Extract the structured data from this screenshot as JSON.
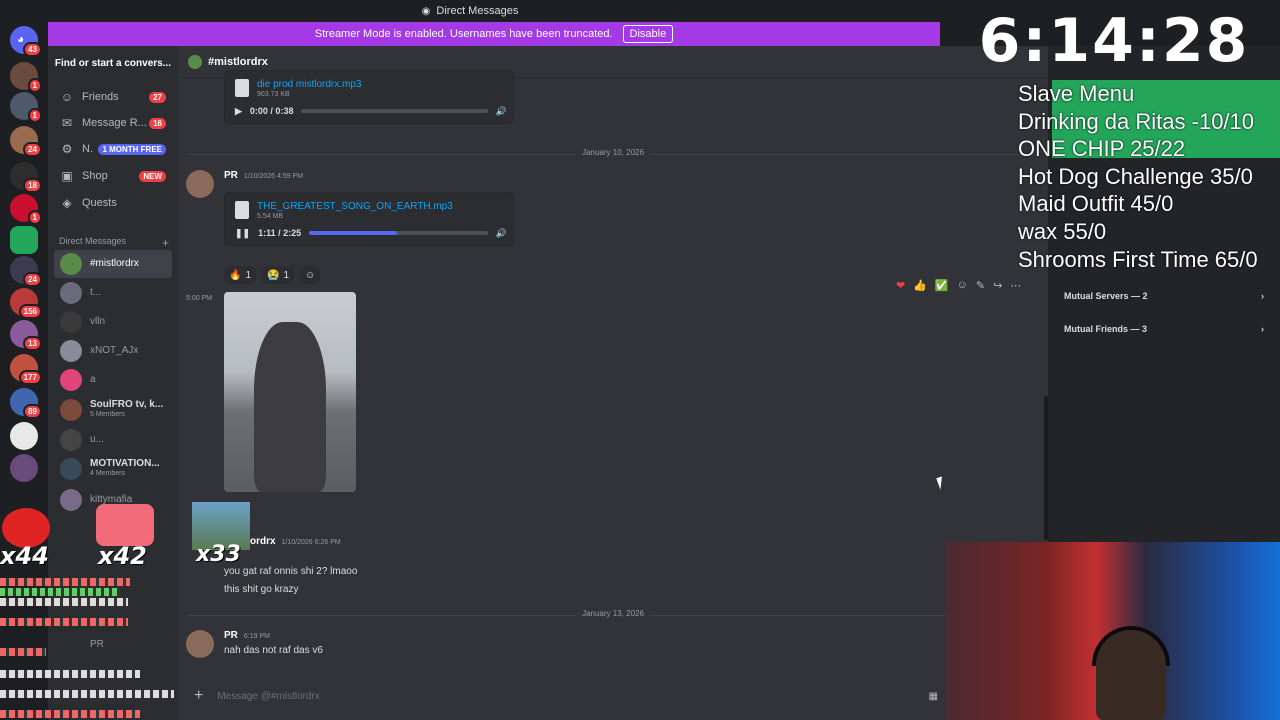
{
  "window": {
    "title": "Direct Messages"
  },
  "banner": {
    "text": "Streamer Mode is enabled. Usernames have been truncated.",
    "button": "Disable"
  },
  "server_rail": {
    "home_badge": "43",
    "badges": [
      "1",
      "1",
      "24",
      "18",
      "1",
      "24",
      "156",
      "13",
      "177",
      "89"
    ]
  },
  "dm_sidebar": {
    "search": "Find or start a convers...",
    "nav": [
      {
        "label": "Friends",
        "icon": "friends-icon",
        "badge": "27"
      },
      {
        "label": "Message R...",
        "icon": "inbox-icon",
        "badge": "16"
      },
      {
        "label": "N.",
        "icon": "nitro-icon",
        "badge": "1 MONTH FREE"
      },
      {
        "label": "Shop",
        "icon": "shop-icon",
        "badge": "NEW"
      },
      {
        "label": "Quests",
        "icon": "quests-icon",
        "badge": ""
      }
    ],
    "dm_header": "Direct Messages",
    "dm_add": "+",
    "dms": [
      {
        "name": "#mistlordrx",
        "sub": ""
      },
      {
        "name": "t...",
        "sub": ""
      },
      {
        "name": "vlln",
        "sub": ""
      },
      {
        "name": "xNOT_AJx",
        "sub": ""
      },
      {
        "name": "a",
        "sub": ""
      },
      {
        "name": "SoulFRO tv, k...",
        "sub": "5 Members"
      },
      {
        "name": "u...",
        "sub": ""
      },
      {
        "name": "MOTIVATION...",
        "sub": "4 Members"
      },
      {
        "name": "kittymafia",
        "sub": ""
      },
      {
        "name": "PR",
        "sub": ""
      }
    ]
  },
  "chat": {
    "channel": "#mistlordrx",
    "top_attachment": {
      "filename": "die prod mistlordrx.mp3",
      "size": "903.73 KB",
      "time": "0:00 / 0:38",
      "progress": 0.0
    },
    "date1": "January 10, 2026",
    "msg1": {
      "author": "PR",
      "timestamp": "1/10/2026 4:59 PM",
      "attachment": {
        "filename": "THE_GREATEST_SONG_ON_EARTH.mp3",
        "size": "5.54 MB",
        "time": "1:11 / 2:25",
        "progress": 0.49
      },
      "reactions": [
        {
          "emoji": "🔥",
          "count": "1"
        },
        {
          "emoji": "😭",
          "count": "1"
        }
      ]
    },
    "msg2": {
      "timestamp": "5:00 PM"
    },
    "msg3": {
      "author": "ordrx",
      "timestamp": "1/10/2026 6:26 PM",
      "lines": [
        "you gat raf onnis shi 2? lmaoo",
        "this shit go krazy"
      ]
    },
    "date2": "January 13, 2026",
    "msg4": {
      "author": "PR",
      "timestamp": "6:19 PM",
      "text": "nah das not raf das v6"
    },
    "composer_placeholder": "Message @#mistlordrx",
    "hover_actions": [
      "❤",
      "👍",
      "✅",
      "☺",
      "✎",
      "↪",
      "⋯"
    ]
  },
  "profile": {
    "mutual_servers": "Mutual Servers — 2",
    "mutual_friends": "Mutual Friends — 3"
  },
  "overlay": {
    "clock": "6:14:28",
    "menu": [
      "Slave Menu",
      "Drinking da Ritas -10/10",
      "ONE CHIP 25/22",
      "Hot Dog Challenge  35/0",
      "Maid Outfit 45/0",
      "wax 55/0",
      "Shrooms First Time 65/0"
    ],
    "multipliers": [
      "x44",
      "x42",
      "x33"
    ]
  },
  "colors": {
    "accent": "#5865f2",
    "banner": "#a33ae6",
    "danger": "#f23f43",
    "link": "#00a8fc"
  }
}
